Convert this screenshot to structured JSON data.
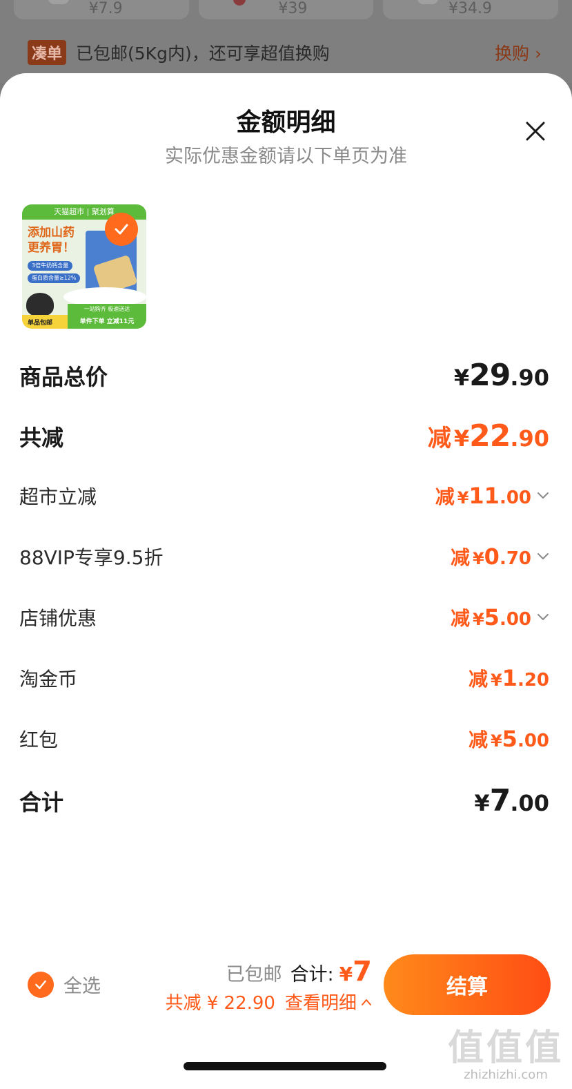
{
  "background": {
    "cards": [
      {
        "price": "¥7.9"
      },
      {
        "price": "¥39"
      },
      {
        "price": "¥34.9"
      }
    ],
    "banner": {
      "tag": "凑单",
      "text": "已包邮(5Kg内)，还可享超值换购",
      "link": "换购 ›"
    }
  },
  "sheet": {
    "title": "金额明细",
    "subtitle": "实际优惠金额请以下单页为准",
    "close_icon": "close-icon"
  },
  "product": {
    "top_bar": "天猫超市 | 聚划算",
    "headline_1": "添加山药",
    "headline_2": "更养胃！",
    "pill_1": "3倍牛奶钙含量",
    "pill_2": "蛋白质含量≥12%",
    "green_bar": "一站购齐 极速送达",
    "footer_left": "单品包邮",
    "footer_right": "单件下单 立减11元"
  },
  "breakdown": {
    "goods_total": {
      "label": "商品总价",
      "prefix": "",
      "yen": "¥",
      "int": "29",
      "dec": ".90"
    },
    "total_reduction": {
      "label": "共减",
      "prefix": "减",
      "yen": "¥",
      "int": "22",
      "dec": ".90"
    },
    "items": [
      {
        "label": "超市立减",
        "prefix": "减",
        "yen": "¥",
        "int": "11",
        "dec": ".00",
        "expandable": true
      },
      {
        "label": "88VIP专享9.5折",
        "prefix": "减",
        "yen": "¥",
        "int": "0",
        "dec": ".70",
        "expandable": true
      },
      {
        "label": "店铺优惠",
        "prefix": "减",
        "yen": "¥",
        "int": "5",
        "dec": ".00",
        "expandable": true
      },
      {
        "label": "淘金币",
        "prefix": "减",
        "yen": "¥",
        "int": "1",
        "dec": ".20",
        "expandable": false
      },
      {
        "label": "红包",
        "prefix": "减",
        "yen": "¥",
        "int": "5",
        "dec": ".00",
        "expandable": false
      }
    ],
    "grand_total": {
      "label": "合计",
      "prefix": "",
      "yen": "¥",
      "int": "7",
      "dec": ".00"
    }
  },
  "bottom_bar": {
    "select_all": "全选",
    "shipping": "已包邮",
    "total_label": "合计:",
    "total_yen": "¥",
    "total_value": "7",
    "reduction_text": "共减 ¥ 22.90",
    "detail_link": "查看明细",
    "checkout": "结算"
  },
  "watermark": {
    "big": "值值值",
    "small": "zhizhizhi.com"
  },
  "colors": {
    "accent": "#ff5a1a",
    "checkout_start": "#ff8a1a",
    "checkout_end": "#ff4d14",
    "muted": "#8a8a8a"
  }
}
